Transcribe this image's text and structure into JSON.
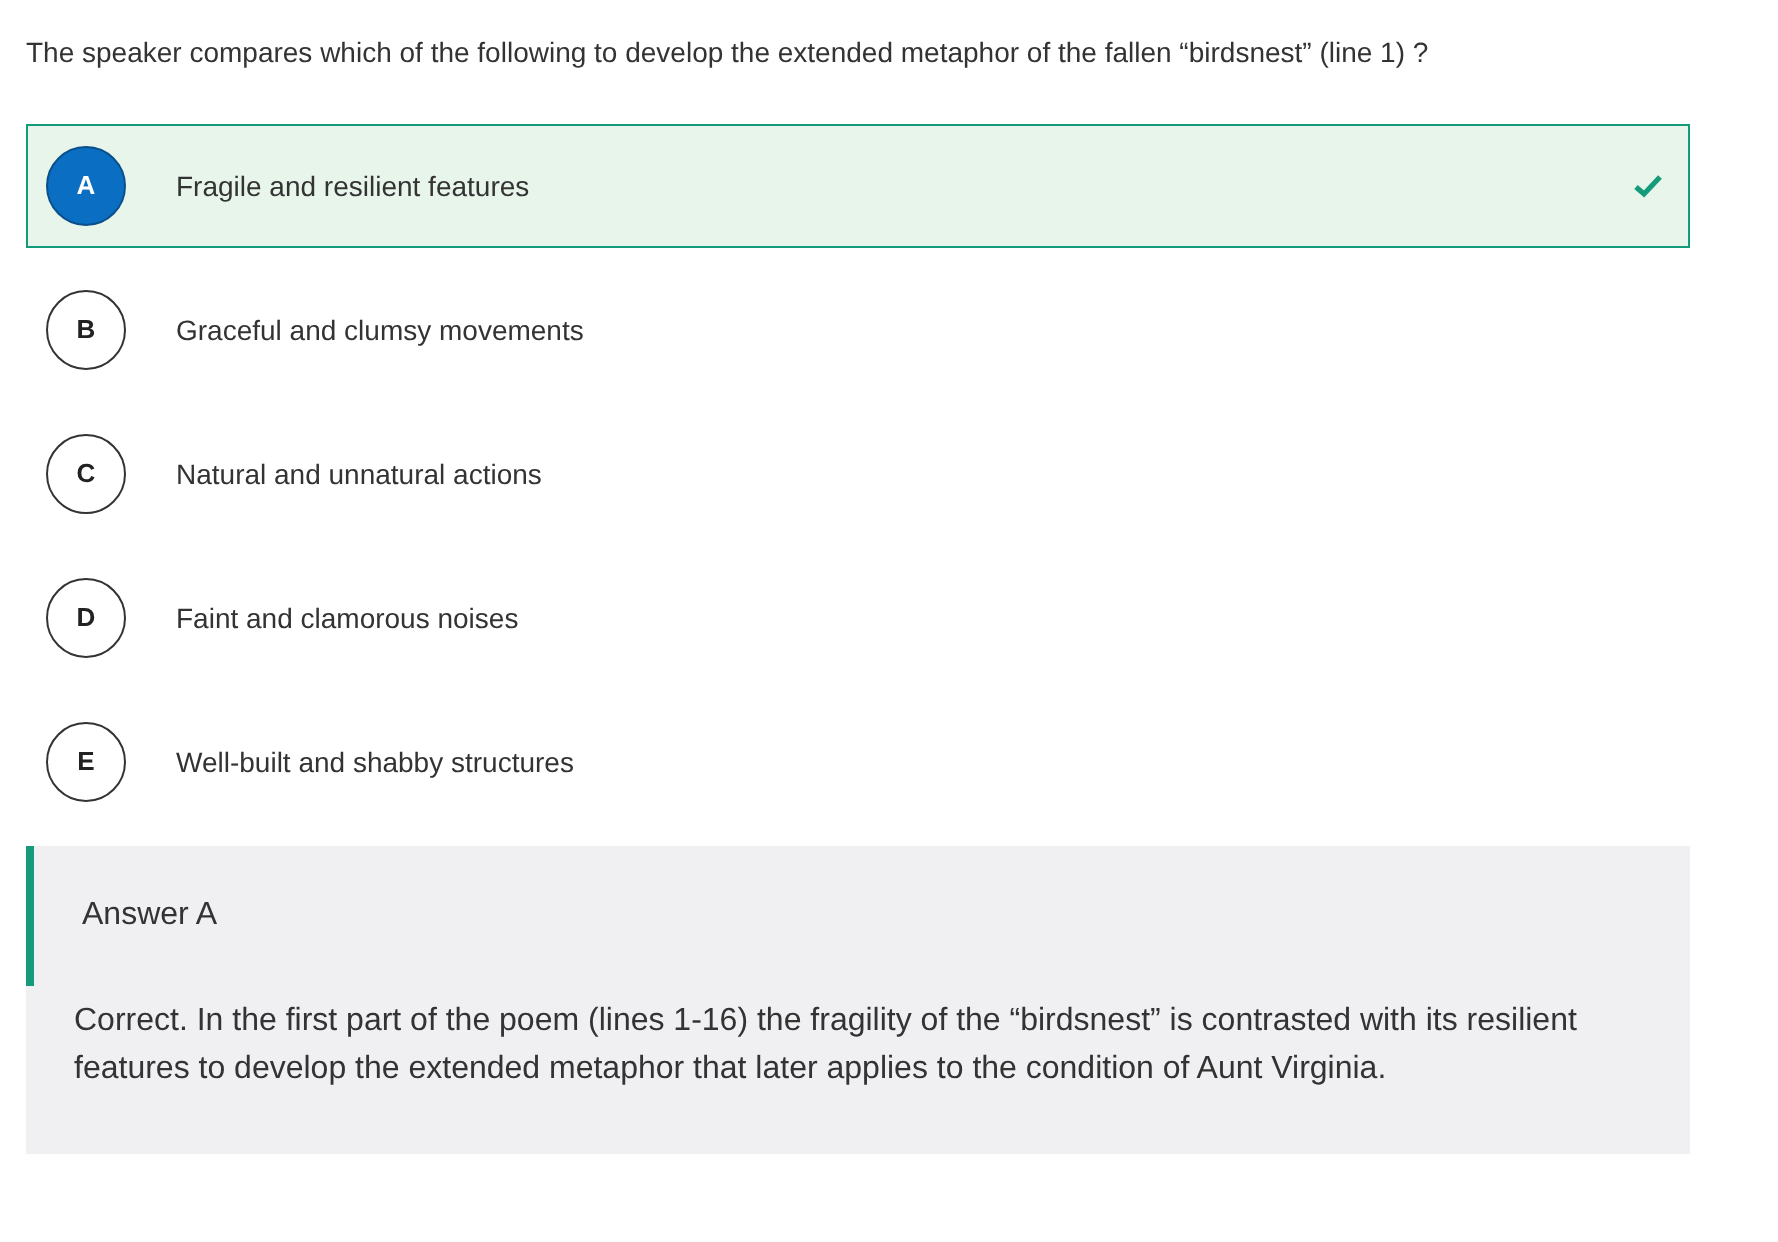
{
  "question": "The speaker compares which of the following to develop the extended metaphor of the fallen “birdsnest” (line 1) ?",
  "options": [
    {
      "letter": "A",
      "text": "Fragile and resilient features",
      "selected": true,
      "correct": true
    },
    {
      "letter": "B",
      "text": "Graceful and clumsy movements",
      "selected": false,
      "correct": false
    },
    {
      "letter": "C",
      "text": "Natural and unnatural actions",
      "selected": false,
      "correct": false
    },
    {
      "letter": "D",
      "text": "Faint and clamorous noises",
      "selected": false,
      "correct": false
    },
    {
      "letter": "E",
      "text": "Well-built and shabby structures",
      "selected": false,
      "correct": false
    }
  ],
  "explanation": {
    "title": "Answer A",
    "body": "Correct. In the first part of the poem (lines 1-16) the fragility of the “birdsnest” is contrasted with its resilient features to develop the extended metaphor that later applies to the condition of Aunt Virginia."
  }
}
